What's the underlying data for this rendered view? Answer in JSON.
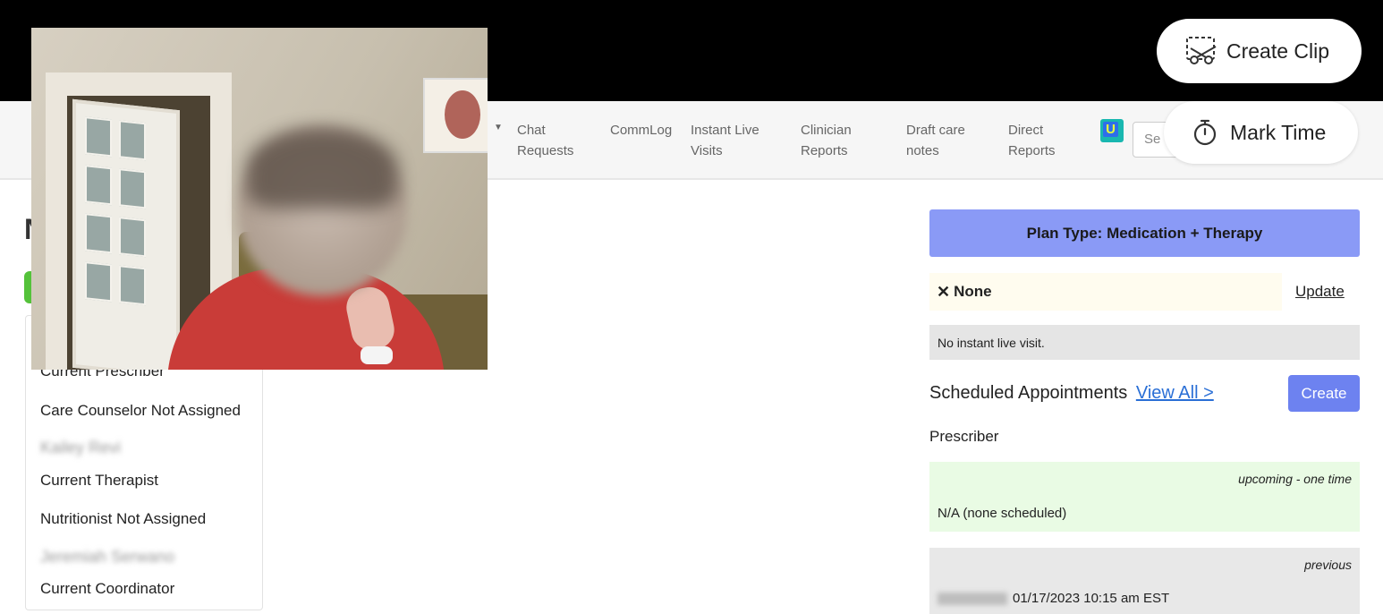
{
  "overlay": {
    "create_clip_label": "Create Clip",
    "mark_time_label": "Mark Time"
  },
  "nav": {
    "items": [
      {
        "line1": "Chat",
        "line2": "Requests"
      },
      {
        "line1": "CommLog",
        "line2": ""
      },
      {
        "line1": "Instant Live",
        "line2": "Visits"
      },
      {
        "line1": "Clinician",
        "line2": "Reports"
      },
      {
        "line1": "Draft care",
        "line2": "notes"
      },
      {
        "line1": "Direct",
        "line2": "Reports"
      }
    ],
    "logo_letter": "U",
    "search_placeholder": "Se"
  },
  "page": {
    "heading_fragment": "N"
  },
  "care_team": {
    "prescriber_role": "Current Prescriber",
    "counselor": "Care Counselor Not Assigned",
    "therapist_name": "Kailey Revi",
    "therapist_role": "Current Therapist",
    "nutritionist": "Nutritionist Not Assigned",
    "coordinator_name": "Jeremiah Serwano",
    "coordinator_role": "Current Coordinator"
  },
  "plan": {
    "type_label": "Plan Type: Medication + Therapy",
    "status": "None",
    "status_icon": "x-icon",
    "update_label": "Update",
    "live_visit_text": "No instant live visit."
  },
  "appointments": {
    "title": "Scheduled Appointments",
    "view_all": "View All >",
    "create_label": "Create",
    "prescriber_label": "Prescriber",
    "upcoming_tag": "upcoming - one time",
    "upcoming_text": "N/A (none scheduled)",
    "previous_tag": "previous",
    "previous_text": "01/17/2023 10:15 am EST"
  },
  "colors": {
    "plan_banner": "#8a9af6",
    "create_button": "#6d82f0",
    "upcoming_bg": "#e9fbe4",
    "link": "#2a6fd6"
  }
}
